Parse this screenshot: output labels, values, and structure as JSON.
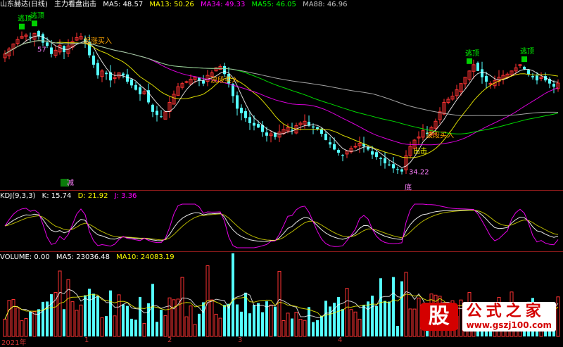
{
  "main_panel": {
    "stock_title": "山东赫达(日线)",
    "indicator_name": "主力看盘出击",
    "ma": [
      {
        "label": "MA5: 48.57",
        "color": "#ffffff"
      },
      {
        "label": "MA13: 50.26",
        "color": "#ffff00"
      },
      {
        "label": "MA34: 49.33",
        "color": "#ff00ff"
      },
      {
        "label": "MA55: 46.05",
        "color": "#00ff00"
      },
      {
        "label": "MA88: 46.96",
        "color": "#c0c0c0"
      }
    ]
  },
  "kdj_panel": {
    "title": "KDJ(9,3,3)",
    "k": "K: 15.74",
    "d": "D: 21.92",
    "j": "J: 3.36"
  },
  "volume_panel": {
    "title": "VOLUME: 0.00",
    "ma5": "MA5: 23036.48",
    "ma10": "MA10: 24083.19"
  },
  "x_axis": {
    "year_label": "2021年",
    "month_labels": [
      "1",
      "2",
      "3",
      "4"
    ]
  },
  "watermark": {
    "logo_char": "股",
    "brand": "公式之家",
    "url": "www.gszj100.com"
  },
  "chart_data": [
    {
      "type": "candlestick",
      "title": "山东赫达(日线)",
      "annotations": [
        {
          "text": "逃顶",
          "candle": 4
        },
        {
          "text": "逃顶",
          "candle": 7
        },
        {
          "text": "57",
          "candle": 7
        },
        {
          "text": "起涨买入",
          "candle": 18
        },
        {
          "text": "波段买入",
          "candle": 48
        },
        {
          "text": "逃顶",
          "candle": 110
        },
        {
          "text": "逃顶",
          "candle": 123
        },
        {
          "text": "波段买入",
          "candle": 99
        },
        {
          "text": "出击",
          "candle": 96
        },
        {
          "text": "34.22",
          "candle": 95
        },
        {
          "text": "底",
          "candle": 94
        },
        {
          "text": "减",
          "candle": 14
        }
      ],
      "close": [
        53.2,
        54.0,
        54.8,
        55.5,
        56.0,
        56.2,
        55.8,
        56.5,
        56.0,
        55.0,
        54.5,
        53.2,
        53.8,
        54.6,
        53.5,
        54.5,
        55.2,
        55.8,
        56.0,
        55.0,
        53.0,
        51.5,
        49.8,
        50.5,
        50.0,
        49.0,
        49.5,
        50.2,
        49.8,
        48.8,
        48.2,
        47.5,
        46.8,
        47.2,
        45.5,
        44.0,
        43.5,
        43.2,
        44.0,
        45.5,
        46.8,
        48.0,
        48.5,
        48.8,
        49.2,
        49.5,
        49.0,
        48.5,
        49.8,
        50.2,
        51.0,
        51.2,
        50.0,
        48.5,
        46.5,
        44.5,
        43.8,
        43.0,
        42.2,
        41.8,
        41.5,
        40.8,
        40.2,
        40.5,
        40.0,
        40.8,
        41.2,
        41.5,
        41.0,
        41.8,
        42.2,
        42.5,
        41.8,
        41.5,
        41.2,
        40.5,
        39.5,
        38.8,
        38.0,
        37.5,
        37.0,
        37.8,
        38.2,
        38.5,
        39.0,
        38.5,
        38.0,
        37.2,
        36.8,
        36.5,
        35.8,
        35.5,
        35.0,
        34.8,
        34.5,
        37.0,
        38.5,
        39.5,
        40.0,
        41.0,
        40.5,
        41.5,
        42.5,
        44.0,
        45.5,
        46.0,
        46.5,
        47.5,
        48.5,
        49.5,
        50.5,
        51.5,
        50.5,
        49.5,
        48.8,
        48.5,
        49.0,
        49.5,
        49.8,
        50.0,
        50.5,
        51.0,
        51.5,
        50.8,
        50.0,
        49.5,
        49.0,
        49.5,
        49.0,
        48.5,
        48.0,
        48.57
      ],
      "x_labels": [
        "2021年",
        "1",
        "2",
        "3",
        "4"
      ],
      "series": [
        {
          "name": "MA5",
          "color": "#ffffff",
          "last": 48.57
        },
        {
          "name": "MA13",
          "color": "#ffff00",
          "last": 50.26
        },
        {
          "name": "MA34",
          "color": "#ff00ff",
          "last": 49.33
        },
        {
          "name": "MA55",
          "color": "#00ff00",
          "last": 46.05
        },
        {
          "name": "MA88",
          "color": "#c0c0c0",
          "last": 46.96
        }
      ]
    },
    {
      "type": "line",
      "title": "KDJ(9,3,3)",
      "series": [
        {
          "name": "K",
          "color": "#ffffff",
          "last": 15.74
        },
        {
          "name": "D",
          "color": "#ffff00",
          "last": 21.92
        },
        {
          "name": "J",
          "color": "#ff00ff",
          "last": 3.36
        }
      ]
    },
    {
      "type": "bar",
      "title": "VOLUME",
      "series": [
        {
          "name": "MA5",
          "color": "#ffffff",
          "last": 23036.48
        },
        {
          "name": "MA10",
          "color": "#ffff00",
          "last": 24083.19
        }
      ]
    }
  ]
}
